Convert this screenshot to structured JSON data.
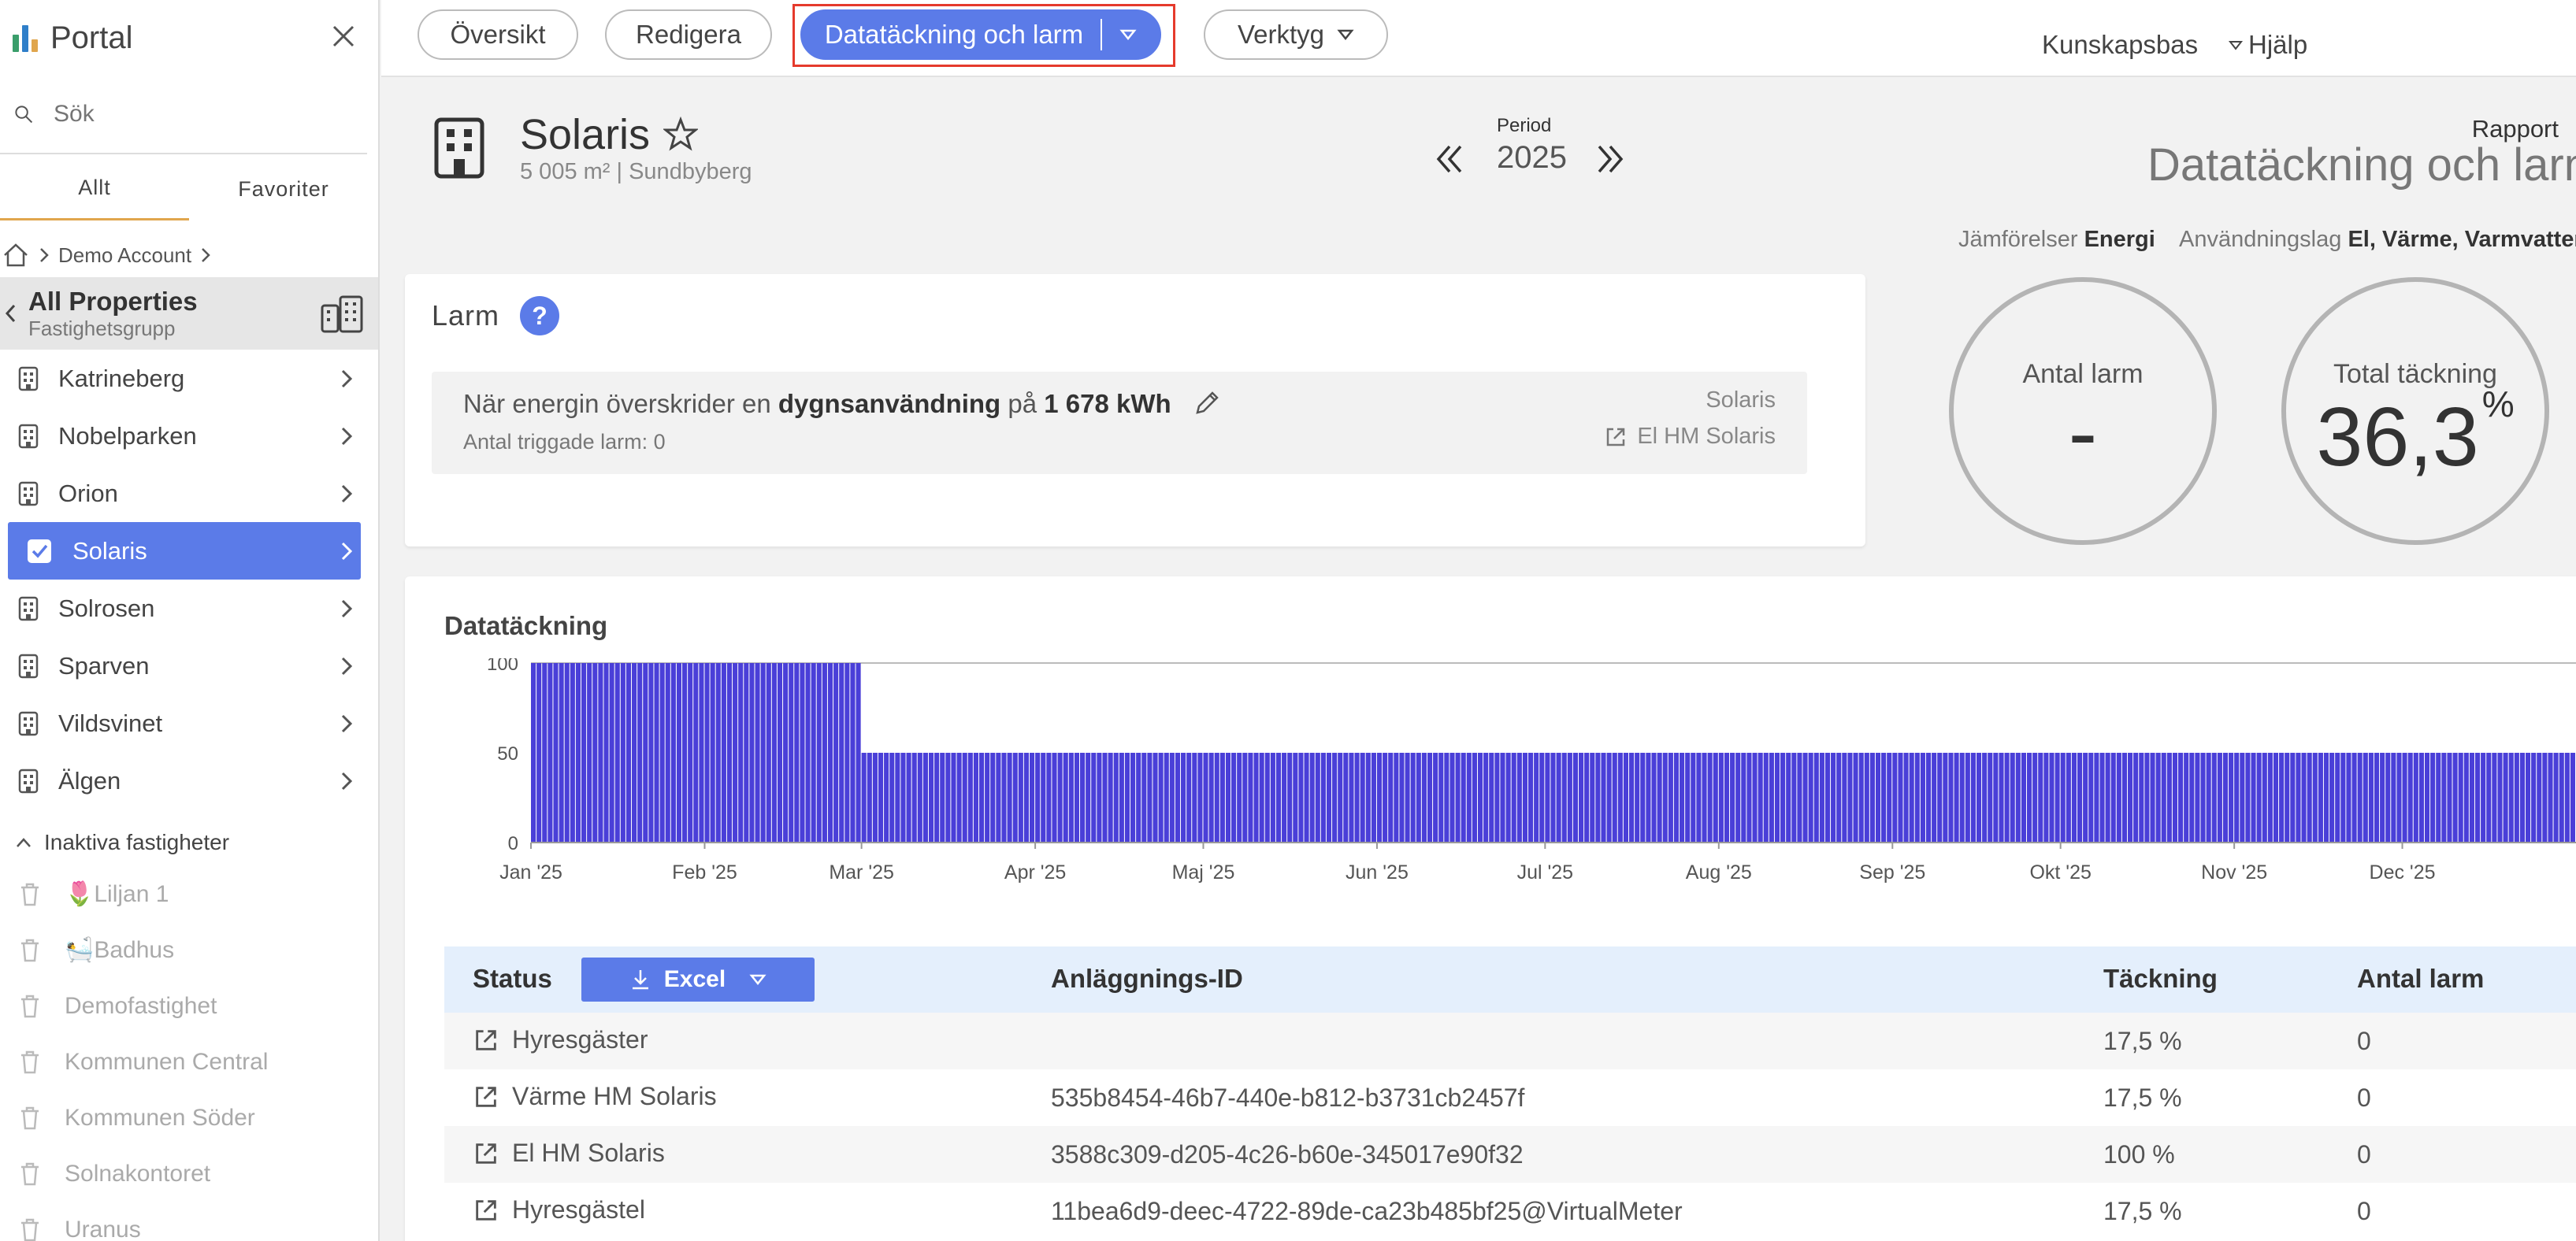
{
  "sidebar": {
    "title": "Portal",
    "search_placeholder": "Sök",
    "tabs": [
      "Allt",
      "Favoriter"
    ],
    "breadcrumb": "Demo Account",
    "group": {
      "name": "All Properties",
      "subtitle": "Fastighetsgrupp"
    },
    "properties": [
      {
        "name": "Katrineberg",
        "active": false
      },
      {
        "name": "Nobelparken",
        "active": false
      },
      {
        "name": "Orion",
        "active": false
      },
      {
        "name": "Solaris",
        "active": true
      },
      {
        "name": "Solrosen",
        "active": false
      },
      {
        "name": "Sparven",
        "active": false
      },
      {
        "name": "Vildsvinet",
        "active": false
      },
      {
        "name": "Älgen",
        "active": false
      }
    ],
    "inactive_header": "Inaktiva fastigheter",
    "inactive": [
      "🌷Liljan 1",
      "🛀Badhus",
      "Demofastighet",
      "Kommunen Central",
      "Kommunen Söder",
      "Solnakontoret",
      "Uranus"
    ]
  },
  "topbar": {
    "tab_overview": "Översikt",
    "tab_edit": "Redigera",
    "tab_active": "Datatäckning och larm",
    "tab_tools": "Verktyg",
    "link_kb": "Kunskapsbas",
    "link_help": "Hjälp"
  },
  "header": {
    "property": "Solaris",
    "subtitle": "5 005 m² | Sundbyberg",
    "period_label": "Period",
    "period_year": "2025",
    "report_label": "Rapport",
    "report_name": "Datatäckning och larm",
    "compare_label": "Jämförelser",
    "compare_value": "Energi",
    "usage_label": "Användningslag",
    "usage_value": "El, Värme, Varmvatten"
  },
  "kpis": {
    "alarms_label": "Antal larm",
    "alarms_value": "-",
    "coverage_label": "Total täckning",
    "coverage_value": "36,3",
    "coverage_unit": "%"
  },
  "larm": {
    "title": "Larm",
    "help": "?",
    "text_pre": "När energin överskrider en",
    "text_bold1": "dygnsanvändning",
    "text_mid": "på",
    "text_bold2": "1 678 kWh",
    "count": "Antal triggade larm: 0",
    "property": "Solaris",
    "meter": "El HM Solaris"
  },
  "chart_data": {
    "type": "bar",
    "title": "Datatäckning",
    "xlabel": "",
    "ylabel": "",
    "ylim": [
      0,
      100
    ],
    "yticks": [
      "100",
      "50",
      "0"
    ],
    "month_labels": [
      "Jan '25",
      "Feb '25",
      "Mar '25",
      "Apr '25",
      "Maj '25",
      "Jun '25",
      "Jul '25",
      "Aug '25",
      "Sep '25",
      "Okt '25",
      "Nov '25",
      "Dec '25"
    ],
    "bar_color": "#4a3fd8",
    "series": [
      {
        "x_start": "2025-01-01",
        "x_end": "2025-02-28",
        "value": 100
      },
      {
        "x_start": "2025-03-01",
        "x_end": "2025-12-31",
        "value": 50
      }
    ],
    "grid": false
  },
  "table": {
    "headers": {
      "status": "Status",
      "excel": "Excel",
      "id": "Anläggnings-ID",
      "coverage": "Täckning",
      "alarms": "Antal larm"
    },
    "rows": [
      {
        "name": "Hyresgäster",
        "id": "",
        "coverage": "17,5 %",
        "alarms": "0"
      },
      {
        "name": "Värme HM Solaris",
        "id": "535b8454-46b7-440e-b812-b3731cb2457f",
        "coverage": "17,5 %",
        "alarms": "0"
      },
      {
        "name": "El HM Solaris",
        "id": "3588c309-d205-4c26-b60e-345017e90f32",
        "coverage": "100 %",
        "alarms": "0"
      },
      {
        "name": "Hyresgästel",
        "id": "11bea6d9-deec-4722-89de-ca23b485bf25@VirtualMeter",
        "coverage": "17,5 %",
        "alarms": "0"
      }
    ]
  },
  "colors": {
    "accent": "#5b7be8",
    "bar": "#4a3fd8",
    "highlight": "#e53a2c"
  }
}
